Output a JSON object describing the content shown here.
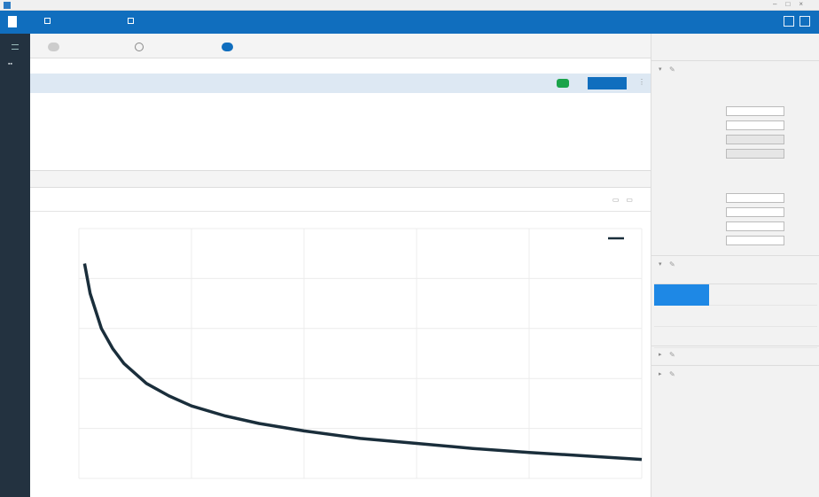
{
  "window": {
    "title": ""
  },
  "toolbar": {
    "logo_label": "",
    "btn1": "",
    "btn2": "",
    "right1": "",
    "right2": ""
  },
  "top_tabs": [
    {
      "label": "",
      "count": ""
    },
    {
      "label": "",
      "count": ""
    },
    {
      "label": "",
      "count": ""
    }
  ],
  "table": {
    "columns": [
      "",
      "",
      ""
    ],
    "row": {
      "name": "",
      "desc": "",
      "action": ""
    }
  },
  "output": {
    "label": "",
    "sub": ""
  },
  "plot_tabs": [
    "",
    "",
    "",
    ""
  ],
  "chart_data": {
    "type": "line",
    "title": "",
    "xlabel": "",
    "ylabel": "",
    "xlim": [
      0,
      5
    ],
    "ylim": [
      0,
      5
    ],
    "grid": true,
    "legend_position": "top-right",
    "xticks": [
      "",
      "",
      "",
      "",
      ""
    ],
    "yticks": [
      "",
      "",
      "",
      "",
      ""
    ],
    "series": [
      {
        "color": "#1a2e3b",
        "x": [
          0.05,
          0.1,
          0.2,
          0.3,
          0.4,
          0.6,
          0.8,
          1.0,
          1.3,
          1.6,
          2.0,
          2.5,
          3.0,
          3.5,
          4.0,
          4.5,
          5.0
        ],
        "y": [
          4.3,
          3.7,
          3.0,
          2.6,
          2.3,
          1.9,
          1.65,
          1.45,
          1.25,
          1.1,
          0.95,
          0.8,
          0.7,
          0.6,
          0.52,
          0.45,
          0.38
        ]
      }
    ]
  },
  "side": {
    "title": "",
    "sec1": "",
    "sec1_sub": "",
    "fields1": [
      {
        "label": "",
        "value": "",
        "unit": ""
      },
      {
        "label": "",
        "value": "",
        "unit": ""
      },
      {
        "label": "",
        "value": "",
        "unit": ""
      },
      {
        "label": "",
        "value": "",
        "unit": ""
      }
    ],
    "sub2": "",
    "fields2": [
      {
        "label": "",
        "value": "",
        "unit": ""
      },
      {
        "label": "",
        "value": "",
        "unit": ""
      },
      {
        "label": "",
        "value": "",
        "unit": ""
      },
      {
        "label": "",
        "value": "",
        "unit": ""
      }
    ],
    "sec2": "",
    "ptable_head": [
      "",
      "",
      "",
      "",
      ""
    ],
    "ptable_rows": [
      [
        "",
        "",
        "",
        "",
        ""
      ],
      [
        "",
        "",
        "",
        "",
        ""
      ],
      [
        "",
        "",
        "",
        "",
        ""
      ]
    ],
    "sec3": "",
    "sec4": "",
    "link": ""
  }
}
